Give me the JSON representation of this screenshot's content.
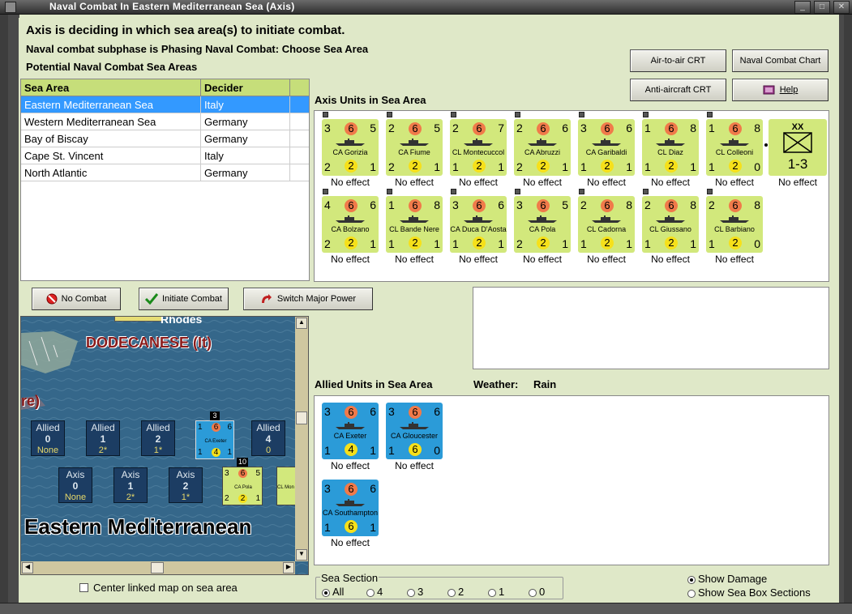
{
  "window": {
    "title": "Naval Combat In Eastern Mediterranean Sea (Axis)"
  },
  "header": {
    "line1": "Axis is deciding in which sea area(s) to initiate combat.",
    "line2": "Naval combat subphase is Phasing Naval Combat: Choose Sea Area",
    "line3": "Potential Naval Combat Sea Areas"
  },
  "buttons": {
    "air_to_air": "Air-to-air CRT",
    "naval_chart": "Naval Combat Chart",
    "anti_aircraft": "Anti-aircraft CRT",
    "help": "Help",
    "no_combat": "No Combat",
    "initiate_combat": "Initiate Combat",
    "switch_power": "Switch Major Power"
  },
  "sea_table": {
    "col1": "Sea Area",
    "col2": "Decider",
    "rows": [
      {
        "area": "Eastern Mediterranean Sea",
        "decider": "Italy",
        "selected": true
      },
      {
        "area": "Western Mediterranean Sea",
        "decider": "Germany",
        "selected": false
      },
      {
        "area": "Bay of Biscay",
        "decider": "Germany",
        "selected": false
      },
      {
        "area": "Cape St. Vincent",
        "decider": "Italy",
        "selected": false
      },
      {
        "area": "North Atlantic",
        "decider": "Germany",
        "selected": false
      }
    ]
  },
  "axis_units": {
    "label": "Axis Units in Sea Area",
    "units": [
      {
        "name": "CA Gorizia",
        "tl": "3",
        "tc": "6",
        "tr": "5",
        "bl": "2",
        "bc": "2",
        "br": "1",
        "effect": "No effect"
      },
      {
        "name": "CA Fiume",
        "tl": "2",
        "tc": "6",
        "tr": "5",
        "bl": "2",
        "bc": "2",
        "br": "1",
        "effect": "No effect"
      },
      {
        "name": "CL Montecuccol",
        "tl": "2",
        "tc": "6",
        "tr": "7",
        "bl": "1",
        "bc": "2",
        "br": "1",
        "effect": "No effect"
      },
      {
        "name": "CA Abruzzi",
        "tl": "2",
        "tc": "6",
        "tr": "6",
        "bl": "2",
        "bc": "2",
        "br": "1",
        "effect": "No effect"
      },
      {
        "name": "CA Garibaldi",
        "tl": "3",
        "tc": "6",
        "tr": "6",
        "bl": "1",
        "bc": "2",
        "br": "1",
        "effect": "No effect"
      },
      {
        "name": "CL Diaz",
        "tl": "1",
        "tc": "6",
        "tr": "8",
        "bl": "1",
        "bc": "2",
        "br": "1",
        "effect": "No effect"
      },
      {
        "name": "CL Colleoni",
        "tl": "1",
        "tc": "6",
        "tr": "8",
        "bl": "1",
        "bc": "2",
        "br": "0",
        "effect": "No effect"
      },
      {
        "name": "CA Bolzano",
        "tl": "4",
        "tc": "6",
        "tr": "6",
        "bl": "2",
        "bc": "2",
        "br": "1",
        "effect": "No effect"
      },
      {
        "name": "CL Bande Nere",
        "tl": "1",
        "tc": "6",
        "tr": "8",
        "bl": "1",
        "bc": "2",
        "br": "1",
        "effect": "No effect"
      },
      {
        "name": "CA Duca D'Aosta",
        "tl": "3",
        "tc": "6",
        "tr": "6",
        "bl": "1",
        "bc": "2",
        "br": "1",
        "effect": "No effect"
      },
      {
        "name": "CA Pola",
        "tl": "3",
        "tc": "6",
        "tr": "5",
        "bl": "2",
        "bc": "2",
        "br": "1",
        "effect": "No effect"
      },
      {
        "name": "CL Cadorna",
        "tl": "2",
        "tc": "6",
        "tr": "8",
        "bl": "1",
        "bc": "2",
        "br": "1",
        "effect": "No effect"
      },
      {
        "name": "CL Giussano",
        "tl": "2",
        "tc": "6",
        "tr": "8",
        "bl": "1",
        "bc": "2",
        "br": "1",
        "effect": "No effect"
      },
      {
        "name": "CL Barbiano",
        "tl": "2",
        "tc": "6",
        "tr": "8",
        "bl": "1",
        "bc": "2",
        "br": "0",
        "effect": "No effect"
      }
    ],
    "hq": {
      "size": "XX",
      "value": "1-3",
      "effect": "No effect"
    }
  },
  "allied_units": {
    "label": "Allied Units in Sea Area",
    "weather_label": "Weather:",
    "weather": "Rain",
    "units": [
      {
        "name": "CA Exeter",
        "tl": "3",
        "tc": "6",
        "tr": "6",
        "bl": "1",
        "bc": "4",
        "br": "1",
        "effect": "No effect"
      },
      {
        "name": "CA Gloucester",
        "tl": "3",
        "tc": "6",
        "tr": "6",
        "bl": "1",
        "bc": "6",
        "br": "0",
        "effect": "No effect"
      },
      {
        "name": "CA Southampton",
        "tl": "3",
        "tc": "6",
        "tr": "6",
        "bl": "1",
        "bc": "6",
        "br": "1",
        "effect": "No effect"
      }
    ]
  },
  "map": {
    "label_top": "Rhodes",
    "label_dodecanese": "DODECANESE (It)",
    "label_partial": "re)",
    "label_sea": "Eastern Mediterranean",
    "allied_boxes": [
      {
        "side": "Allied",
        "num": "0",
        "sub": "None"
      },
      {
        "side": "Allied",
        "num": "1",
        "sub": "2*"
      },
      {
        "side": "Allied",
        "num": "2",
        "sub": "1*"
      },
      {
        "side": "Allied",
        "num": "4",
        "sub": "0"
      }
    ],
    "axis_boxes": [
      {
        "side": "Axis",
        "num": "0",
        "sub": "None"
      },
      {
        "side": "Axis",
        "num": "1",
        "sub": "2*"
      },
      {
        "side": "Axis",
        "num": "2",
        "sub": "1*"
      }
    ],
    "stack_exeter": {
      "count": "3",
      "name": "CA Exeter",
      "tl": "1",
      "tc": "6",
      "tr": "6",
      "bl": "1",
      "bc": "4",
      "br": "1"
    },
    "stack_pola": {
      "count": "10",
      "name": "CA Pola",
      "tl": "3",
      "tc": "6",
      "tr": "5",
      "bl": "2",
      "bc": "2",
      "br": "1"
    },
    "stack_mon": {
      "name": "CL Mon"
    }
  },
  "center_map_checkbox": "Center linked map on sea area",
  "sea_section": {
    "label": "Sea Section",
    "options": [
      "All",
      "4",
      "3",
      "2",
      "1",
      "0"
    ],
    "selected": "All"
  },
  "display": {
    "show_damage": "Show Damage",
    "show_sections": "Show Sea Box Sections"
  },
  "colors": {
    "background": "#dfe8c8",
    "axis_unit": "#d2e87c",
    "allied_unit": "#2b9bd8",
    "selected_row": "#3399ff"
  }
}
